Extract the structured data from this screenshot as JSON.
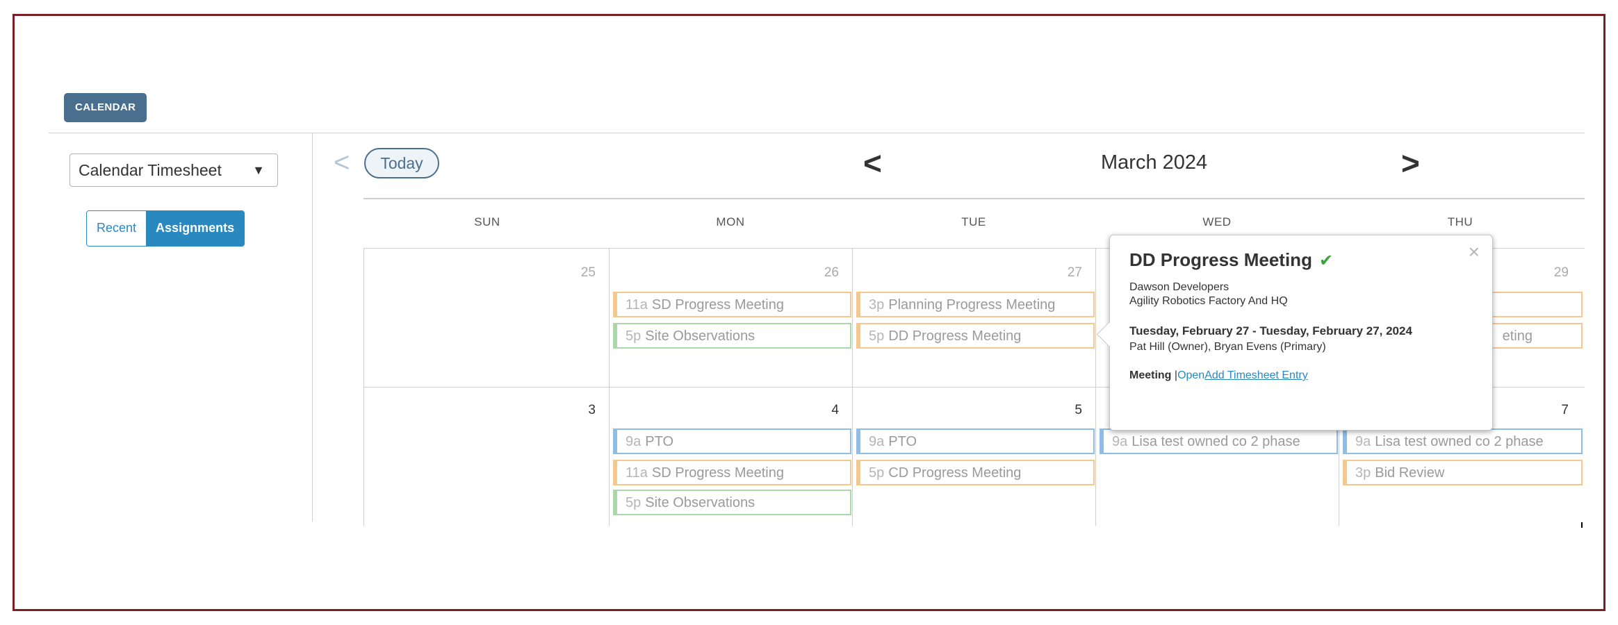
{
  "header": {
    "tag": "CALENDAR"
  },
  "sidebar": {
    "select_value": "Calendar Timesheet",
    "toggle": {
      "recent": "Recent",
      "assignments": "Assignments"
    }
  },
  "toolbar": {
    "today": "Today",
    "month": "March 2024"
  },
  "days_of_week": [
    "SUN",
    "MON",
    "TUE",
    "WED",
    "THU"
  ],
  "weeks": [
    {
      "dates": [
        "25",
        "26",
        "27",
        "",
        "29"
      ]
    },
    {
      "dates": [
        "3",
        "4",
        "5",
        "",
        "7"
      ]
    }
  ],
  "events": {
    "w1_mon_1": {
      "time": "11a",
      "title": "SD Progress Meeting"
    },
    "w1_mon_2": {
      "time": "5p",
      "title": "Site Observations"
    },
    "w1_tue_1": {
      "time": "3p",
      "title": "Planning Progress Meeting"
    },
    "w1_tue_2": {
      "time": "5p",
      "title": "DD Progress Meeting"
    },
    "w1_thu_2": {
      "title": "eting"
    },
    "w2_mon_1": {
      "time": "9a",
      "title": "PTO"
    },
    "w2_mon_2": {
      "time": "11a",
      "title": "SD Progress Meeting"
    },
    "w2_mon_3": {
      "time": "5p",
      "title": "Site Observations"
    },
    "w2_tue_1": {
      "time": "9a",
      "title": "PTO"
    },
    "w2_tue_2": {
      "time": "5p",
      "title": "CD Progress Meeting"
    },
    "w2_wed_1": {
      "time": "9a",
      "title": "Lisa test owned co 2 phase"
    },
    "w2_thu_1": {
      "time": "9a",
      "title": "Lisa test owned co 2 phase"
    },
    "w2_thu_2": {
      "time": "3p",
      "title": "Bid Review"
    }
  },
  "popup": {
    "title": "DD Progress Meeting",
    "company": "Dawson Developers",
    "project": "Agility Robotics Factory And HQ",
    "dates": "Tuesday, February 27 - Tuesday, February 27, 2024",
    "people": "Pat Hill (Owner), Bryan Evens (Primary)",
    "type_label": "Meeting",
    "separator": " |",
    "open_link": "Open",
    "add_entry_link": "Add Timesheet Entry",
    "close": "×"
  },
  "colors": {
    "accent": "#2a88c0",
    "tag_bg": "#4a6f8e",
    "frame": "#7a1f24",
    "event_orange": "#f5c98e",
    "event_green": "#a9d8a9",
    "event_blue": "#8fbde6",
    "check": "#3aa63a"
  },
  "icons": {
    "dropdown": "triangle-down-icon",
    "prev": "chevron-left-icon",
    "next": "chevron-right-icon",
    "check": "checkmark-icon",
    "close": "close-icon"
  }
}
